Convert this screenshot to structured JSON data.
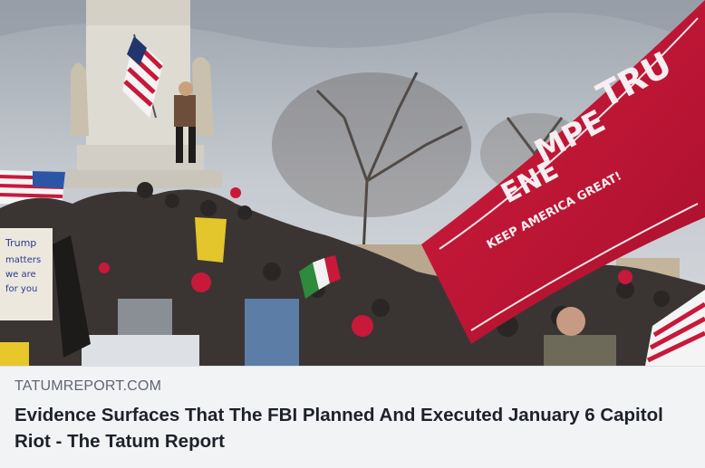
{
  "link_preview": {
    "domain": "TATUMREPORT.COM",
    "headline": "Evidence Surfaces That The FBI Planned And Executed January 6 Capitol Riot - The Tatum Report"
  },
  "photo": {
    "description_icon": "news-photo",
    "flag_text_lines": [
      "TRU",
      "MPE",
      "ENE",
      "KEEP AMERICA GREAT!"
    ],
    "sign_text_lines": [
      "Trump",
      "matters",
      "we are",
      "for you"
    ],
    "colors": {
      "sky": "#c3c8cf",
      "trump_flag": "#c8193a",
      "monument": "#dedbd3"
    }
  }
}
